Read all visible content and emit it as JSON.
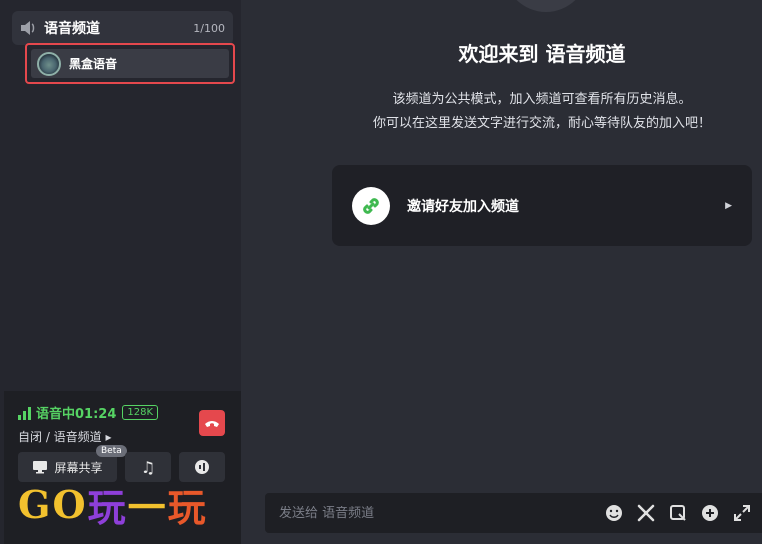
{
  "sidebar": {
    "channel_name": "语音频道",
    "channel_count": "1/100",
    "active_item_label": "黑盒语音"
  },
  "voice_panel": {
    "status": "语音中01:24",
    "bitrate": "128K",
    "path": "自闭 / 语音频道 ▸",
    "screen_share_label": "屏幕共享",
    "beta_label": "Beta",
    "watermark": {
      "p1": "GO",
      "p2": "玩",
      "p3": "一",
      "p4": "玩"
    }
  },
  "main": {
    "title": "欢迎来到 语音频道",
    "desc_line1": "该频道为公共模式，加入频道可查看所有历史消息。",
    "desc_line2": "你可以在这里发送文字进行交流，耐心等待队友的加入吧！",
    "invite_label": "邀请好友加入频道"
  },
  "input": {
    "placeholder": "发送给 语音频道"
  },
  "colors": {
    "accent_green": "#56d364",
    "danger_red": "#e5484d"
  }
}
